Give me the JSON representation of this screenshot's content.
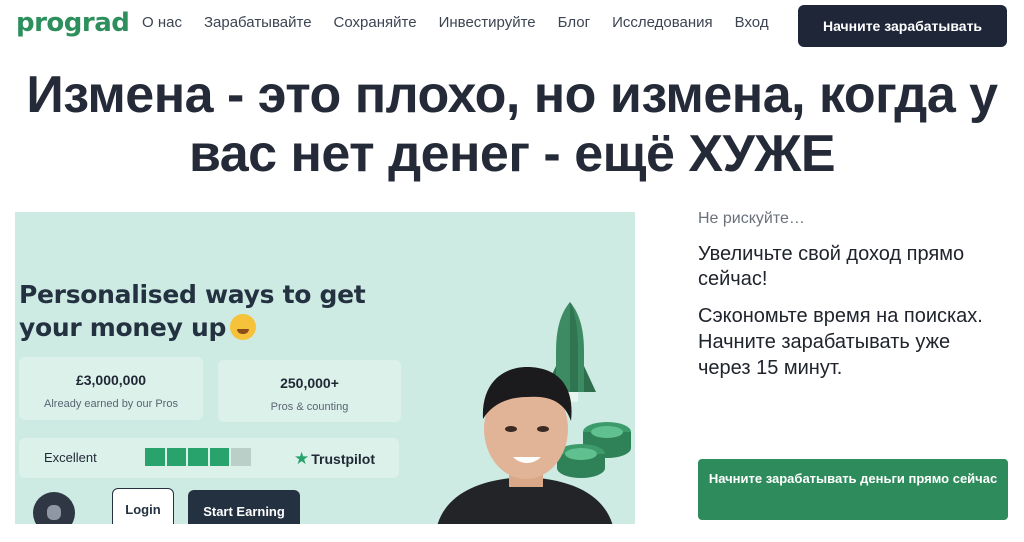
{
  "brand": {
    "logo": "prograd",
    "accent": "#2c8f5c",
    "dark": "#1e2638"
  },
  "nav": {
    "links": [
      "О нас",
      "Зарабатывайте",
      "Сохраняйте",
      "Инвестируйте",
      "Блог",
      "Исследования",
      "Вход"
    ],
    "cta": "Начните зарабатывать"
  },
  "headline": "Измена - это плохо, но измена, когда у вас нет денег - ещё ХУЖЕ",
  "video": {
    "heading_line1": "Personalised ways to get",
    "heading_line2": "your money up",
    "emoji_icon": "money-mouth-face-icon",
    "stats": [
      {
        "value": "£3,000,000",
        "label": "Already earned by our Pros"
      },
      {
        "value": "250,000+",
        "label": "Pros & counting"
      }
    ],
    "rating": {
      "label": "Excellent",
      "filled": 0.9,
      "provider": "Trustpilot"
    },
    "login": "Login",
    "start": "Start Earning"
  },
  "aside": {
    "kicker": "Не рискуйте…",
    "lead": "Увеличьте свой доход прямо сейчас!",
    "body": "Сэкономьте время на поисках. Начните зарабатывать уже через 15 минут.",
    "cta": "Начните зарабатывать деньги прямо сейчас"
  }
}
